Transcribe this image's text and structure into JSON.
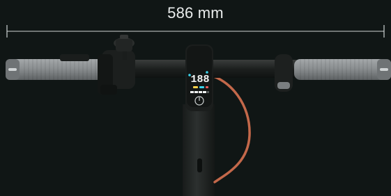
{
  "dimension": {
    "label": "586 mm"
  },
  "display": {
    "speed_readout": "188"
  },
  "colors": {
    "background": "#101615",
    "dimension_line": "#cfd4d4",
    "grip": "#8e9294",
    "frame": "#1f2221",
    "cable": "#c3684a",
    "display_cyan": "#3ad1e8",
    "display_white": "#f2f4f4"
  }
}
